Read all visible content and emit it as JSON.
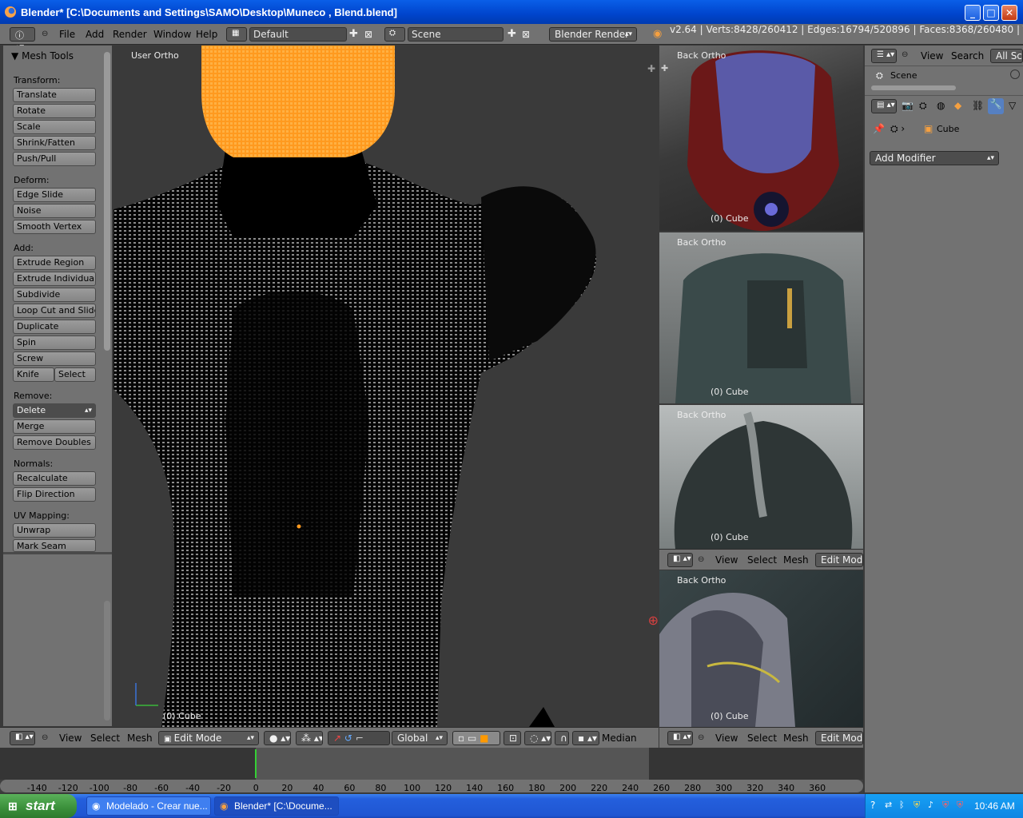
{
  "window": {
    "title": "Blender* [C:\\Documents and Settings\\SAMO\\Desktop\\Muneco , Blend.blend]"
  },
  "menubar": {
    "items": [
      "File",
      "Add",
      "Render",
      "Window",
      "Help"
    ],
    "layout": "Default",
    "scene": "Scene",
    "engine": "Blender Render",
    "status": "v2.64 | Verts:8428/260412 | Edges:16794/520896 | Faces:8368/260480 | Tris:52096"
  },
  "toolshelf": {
    "header": "Mesh Tools",
    "transform_label": "Transform:",
    "transform": [
      "Translate",
      "Rotate",
      "Scale",
      "Shrink/Fatten",
      "Push/Pull"
    ],
    "deform_label": "Deform:",
    "deform": [
      "Edge Slide",
      "Noise",
      "Smooth Vertex"
    ],
    "add_label": "Add:",
    "add": [
      "Extrude Region",
      "Extrude Individual",
      "Subdivide",
      "Loop Cut and Slide",
      "Duplicate",
      "Spin",
      "Screw"
    ],
    "knife": "Knife",
    "select": "Select",
    "remove_label": "Remove:",
    "delete": "Delete",
    "remove": [
      "Merge",
      "Remove Doubles"
    ],
    "normals_label": "Normals:",
    "normals": [
      "Recalculate",
      "Flip Direction"
    ],
    "uv_label": "UV Mapping:",
    "uv": [
      "Unwrap",
      "Mark Seam"
    ]
  },
  "viewport": {
    "view_name": "User Ortho",
    "object_label": "(0) Cube"
  },
  "viewport_header": {
    "view": "View",
    "select": "Select",
    "mesh": "Mesh",
    "mode": "Edit Mode",
    "orientation": "Global",
    "pivot": "Median"
  },
  "ref_views": [
    {
      "view_name": "Back Ortho",
      "object_label": "(0) Cube"
    },
    {
      "view_name": "Back Ortho",
      "object_label": "(0) Cube"
    },
    {
      "view_name": "Back Ortho",
      "object_label": "(0) Cube"
    },
    {
      "view_name": "Back Ortho",
      "object_label": "(0) Cube"
    }
  ],
  "ref_header": {
    "view": "View",
    "select": "Select",
    "mesh": "Mesh",
    "mode": "Edit Mod"
  },
  "properties": {
    "outliner_view": "View",
    "outliner_search": "Search",
    "outliner_filter": "All Sce",
    "scene_item": "Scene",
    "object_name": "Cube",
    "add_modifier": "Add Modifier"
  },
  "timeline": {
    "current_frame": 0,
    "ticks": [
      "-140",
      "-120",
      "-100",
      "-80",
      "-60",
      "-40",
      "-20",
      "0",
      "20",
      "40",
      "60",
      "80",
      "100",
      "120",
      "140",
      "160",
      "180",
      "200",
      "220",
      "240",
      "260",
      "280",
      "300",
      "320",
      "340",
      "360"
    ]
  },
  "taskbar": {
    "start": "start",
    "tasks": [
      "Modelado - Crear nue...",
      "Blender* [C:\\Docume..."
    ],
    "clock": "10:46 AM"
  },
  "colors": {
    "selected_mesh": "#ff9a1f",
    "xp_blue": "#0a5fe8",
    "panel_gray": "#727272"
  }
}
